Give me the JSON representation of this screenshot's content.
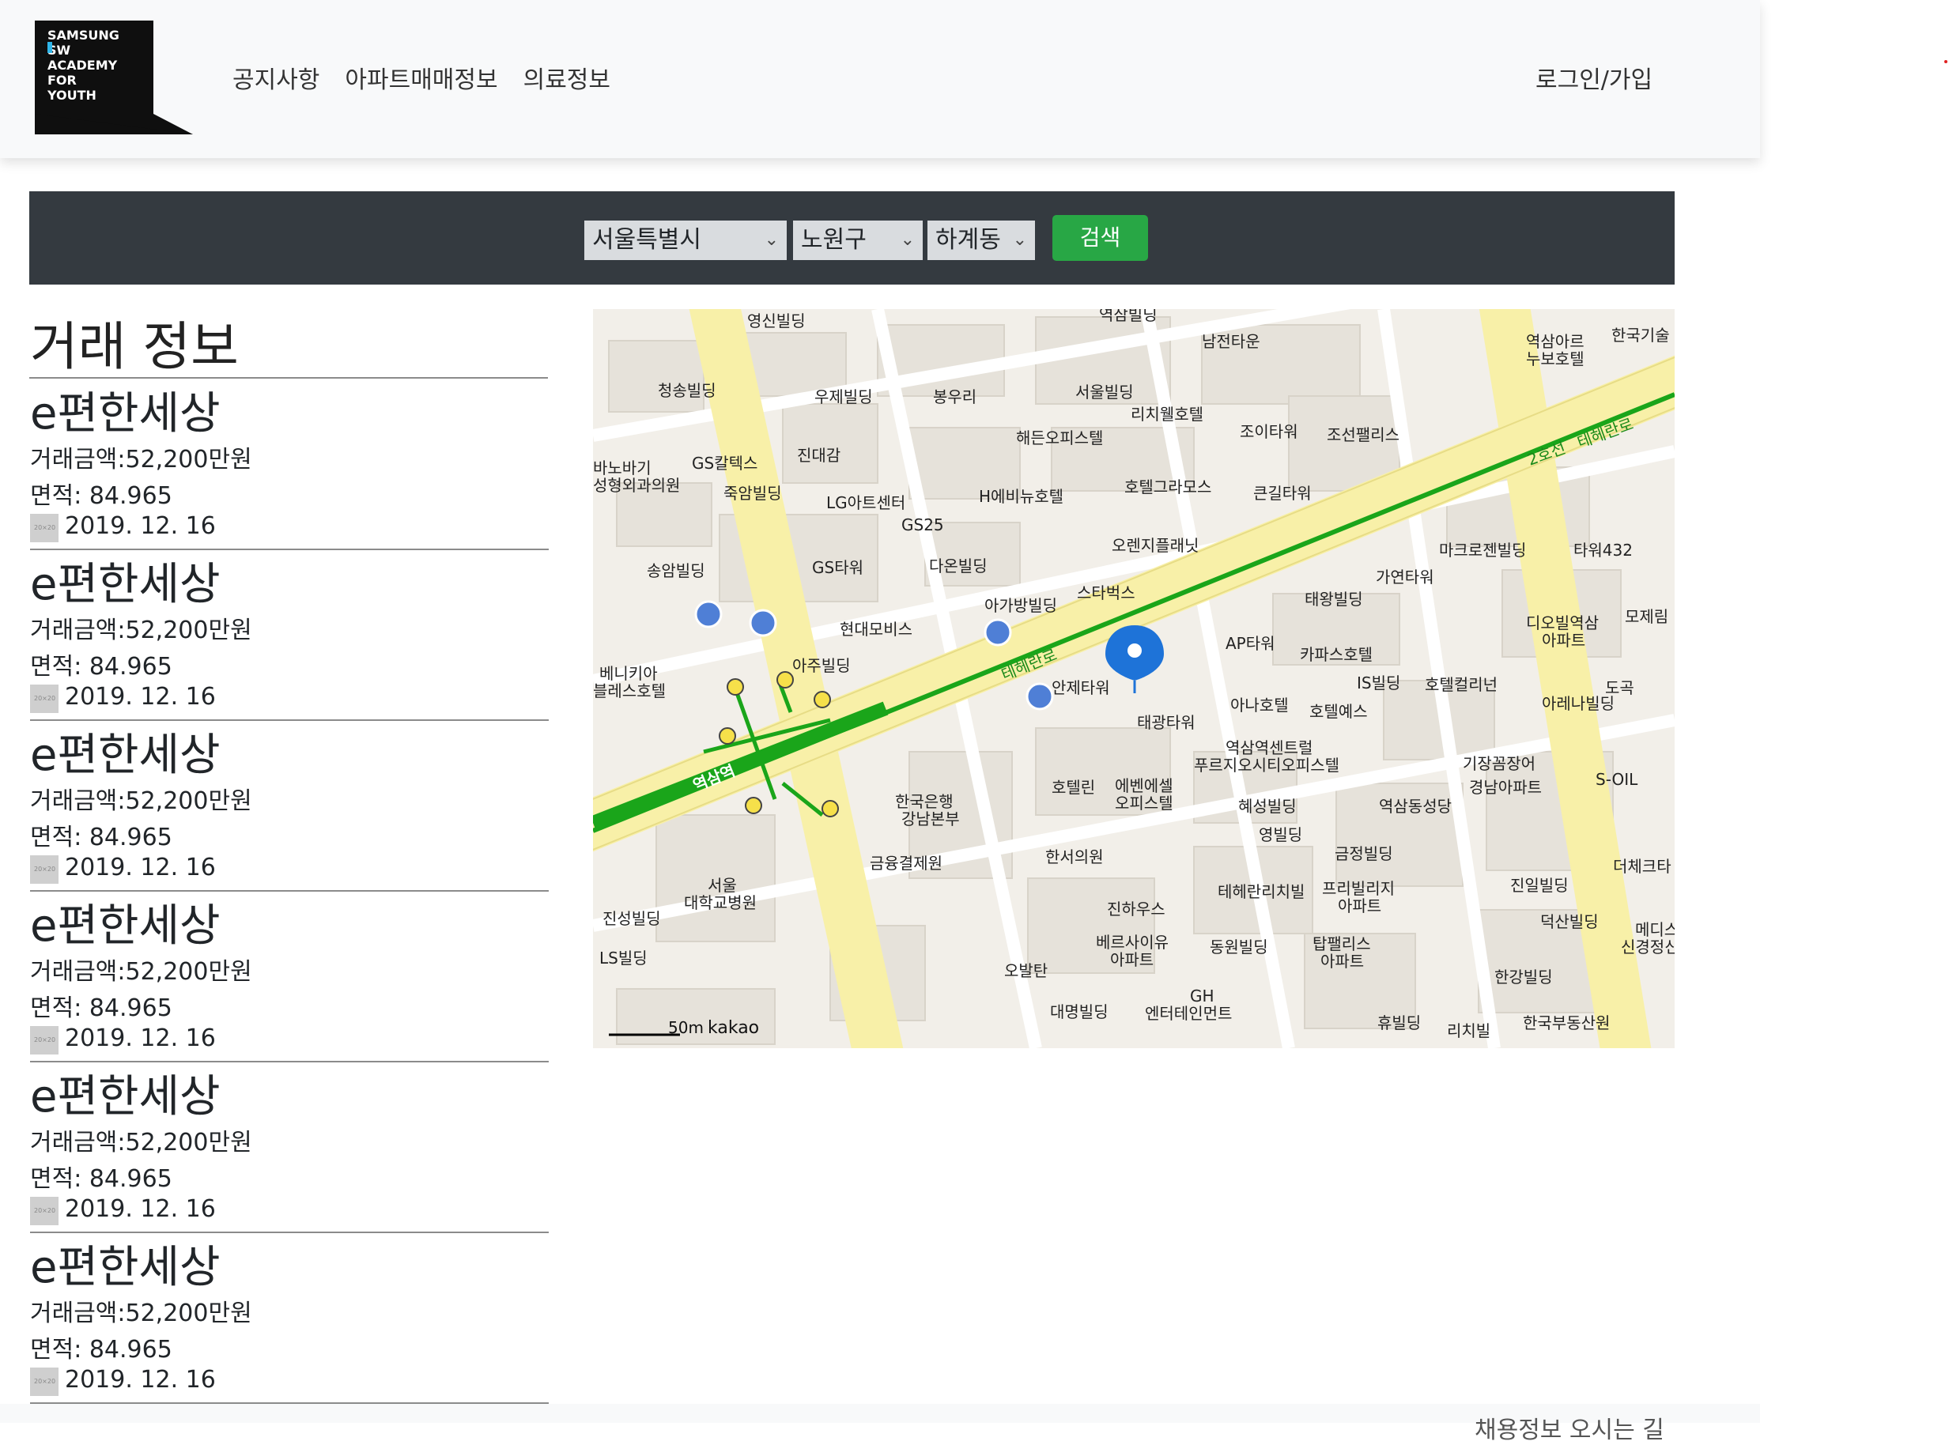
{
  "brand": {
    "logo_lines": [
      "SAMSUNG",
      "SW",
      "ACADEMY",
      "FOR",
      "YOUTH"
    ]
  },
  "nav": {
    "items": [
      "공지사항",
      "아파트매매정보",
      "의료정보"
    ],
    "login": "로그인/가입"
  },
  "search": {
    "city": "서울특별시",
    "district": "노원구",
    "dong": "하계동",
    "button": "검색"
  },
  "deals": {
    "title": "거래 정보",
    "items": [
      {
        "name": "e편한세상",
        "amount": "거래금액:52,200만원",
        "area": "면적: 84.965",
        "date": "2019. 12. 16"
      },
      {
        "name": "e편한세상",
        "amount": "거래금액:52,200만원",
        "area": "면적: 84.965",
        "date": "2019. 12. 16"
      },
      {
        "name": "e편한세상",
        "amount": "거래금액:52,200만원",
        "area": "면적: 84.965",
        "date": "2019. 12. 16"
      },
      {
        "name": "e편한세상",
        "amount": "거래금액:52,200만원",
        "area": "면적: 84.965",
        "date": "2019. 12. 16"
      },
      {
        "name": "e편한세상",
        "amount": "거래금액:52,200만원",
        "area": "면적: 84.965",
        "date": "2019. 12. 16"
      },
      {
        "name": "e편한세상",
        "amount": "거래금액:52,200만원",
        "area": "면적: 84.965",
        "date": "2019. 12. 16"
      }
    ]
  },
  "map": {
    "attribution": "kakao",
    "scale": "50m",
    "labels": [
      "영신빌딩",
      "역삼빌딩",
      "남전타운",
      "청송빌딩",
      "우제빌딩",
      "봉우리",
      "서울빌딩",
      "리치웰호텔",
      "해든오피스텔",
      "조이타워",
      "조선팰리스",
      "역삼역",
      "스타벅스",
      "아가방빌딩",
      "안제타워",
      "현대모비스",
      "아주빌딩",
      "한국은행 강남본부",
      "금융결제원",
      "서울 대학교병원",
      "진성빌딩",
      "LS빌딩",
      "한서의원",
      "진하우스",
      "GS타워",
      "송암빌딩",
      "다온빌딩",
      "오렌지플래닛",
      "호텔그라모스",
      "큰길타워",
      "H에비뉴호텔",
      "LG아트센터",
      "GS25",
      "마크로젠빌딩",
      "가연타워",
      "타워432",
      "디오빌역삼 아파트",
      "태왕빌딩",
      "AP타워",
      "카파스호텔",
      "IS빌딩",
      "호텔컬리넌",
      "아나호텔",
      "호텔예스",
      "태광타워",
      "역삼역센트럴 푸르지오시티오피스텔",
      "에벤에셀 오피스텔",
      "호텔린",
      "혜성빌딩",
      "영빌딩",
      "금정빌딩",
      "테헤란리치빌",
      "프리빌리지 아파트",
      "기장꼼장어",
      "경남아파트",
      "S-OIL",
      "아레나빌딩",
      "역삼동성당",
      "진일빌딩",
      "덕산빌딩",
      "한강빌딩",
      "베르사이유 아파트",
      "동원빌딩",
      "탑팰리스 아파트",
      "대명빌딩",
      "GH 엔터테인먼트",
      "휴빌딩",
      "리치빌",
      "한국부동산원",
      "오발탄",
      "바노바기 성형외과의원",
      "GS칼텍스",
      "죽암빌딩",
      "진대감",
      "베니키아 블레스호텔",
      "역삼아르 누보호텔",
      "한국기술",
      "도곡",
      "메디스 신경정신",
      "더체크타",
      "모제림",
      "2호선",
      "테헤란로"
    ]
  },
  "footer": {
    "links": "채용정보   오시는 길"
  }
}
